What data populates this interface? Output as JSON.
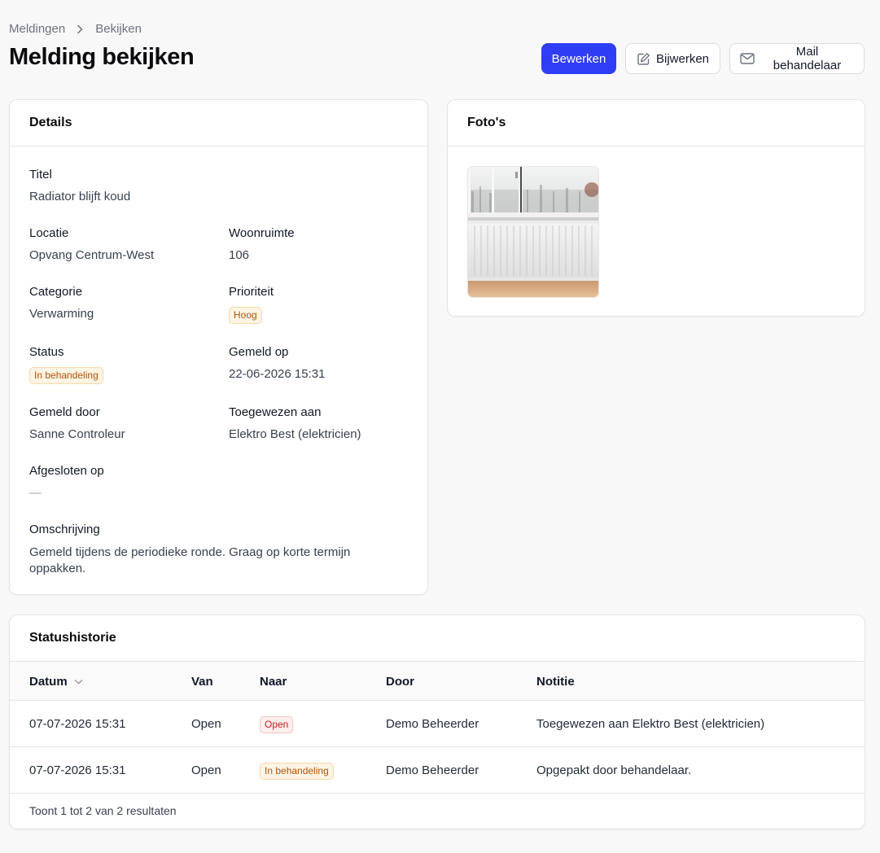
{
  "breadcrumb": {
    "parent": "Meldingen",
    "current": "Bekijken"
  },
  "page_title": "Melding bekijken",
  "actions": {
    "edit": "Bewerken",
    "update": "Bijwerken",
    "mail": "Mail behandelaar"
  },
  "details": {
    "heading": "Details",
    "title_label": "Titel",
    "title_value": "Radiator blijft koud",
    "location_label": "Locatie",
    "location_value": "Opvang Centrum-West",
    "room_label": "Woonruimte",
    "room_value": "106",
    "category_label": "Categorie",
    "category_value": "Verwarming",
    "priority_label": "Prioriteit",
    "priority_value": "Hoog",
    "status_label": "Status",
    "status_value": "In behandeling",
    "reported_on_label": "Gemeld op",
    "reported_on_value": "22-06-2026 15:31",
    "reported_by_label": "Gemeld door",
    "reported_by_value": "Sanne Controleur",
    "assigned_label": "Toegewezen aan",
    "assigned_value": "Elektro Best (elektricien)",
    "closed_label": "Afgesloten op",
    "closed_value": "—",
    "description_label": "Omschrijving",
    "description_value": "Gemeld tijdens de periodieke ronde. Graag op korte termijn oppakken."
  },
  "photos": {
    "heading": "Foto's"
  },
  "history": {
    "heading": "Statushistorie",
    "columns": {
      "date": "Datum",
      "from": "Van",
      "to": "Naar",
      "by": "Door",
      "note": "Notitie"
    },
    "rows": [
      {
        "date": "07-07-2026 15:31",
        "from": "Open",
        "to": "Open",
        "by": "Demo Beheerder",
        "note": "Toegewezen aan Elektro Best (elektricien)"
      },
      {
        "date": "07-07-2026 15:31",
        "from": "Open",
        "to": "In behandeling",
        "by": "Demo Beheerder",
        "note": "Opgepakt door behandelaar."
      }
    ],
    "footer": "Toont 1 tot 2 van 2 resultaten"
  },
  "colors": {
    "primary": "#2f3ef6",
    "warning": "#b45309",
    "danger": "#c81e1e"
  }
}
